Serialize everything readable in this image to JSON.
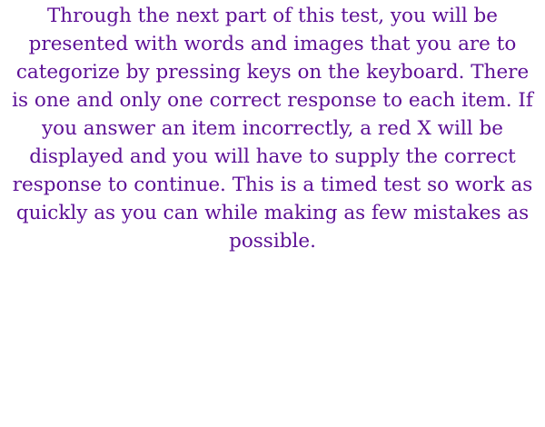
{
  "screen": {
    "instructions_text": "Through the next part of this test, you will be presented with words and images that you are to categorize by pressing keys on the keyboard. There is one and only one correct response to each item. If you answer an item incorrectly, a red X will be displayed and you will have to supply the correct response to continue. This is a timed test so work as quickly as you can while making as few mistakes as possible."
  },
  "colors": {
    "text": "#5c0f95",
    "background": "#ffffff"
  }
}
